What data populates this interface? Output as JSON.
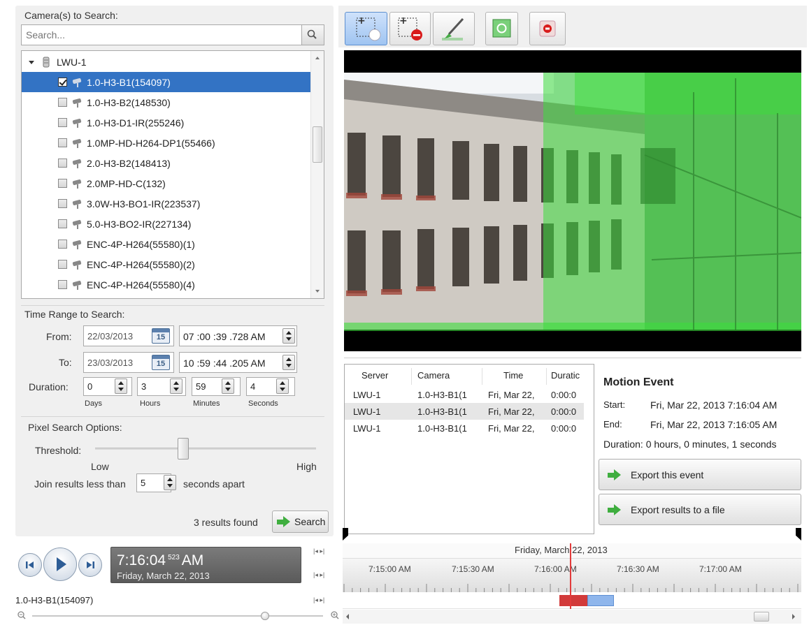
{
  "cameras": {
    "label": "Camera(s) to Search:",
    "search_placeholder": "Search...",
    "server": "LWU-1",
    "items": [
      {
        "label": "1.0-H3-B1(154097)",
        "checked": true,
        "selected": true
      },
      {
        "label": "1.0-H3-B2(148530)",
        "checked": false
      },
      {
        "label": "1.0-H3-D1-IR(255246)",
        "checked": false
      },
      {
        "label": "1.0MP-HD-H264-DP1(55466)",
        "checked": false
      },
      {
        "label": "2.0-H3-B2(148413)",
        "checked": false
      },
      {
        "label": "2.0MP-HD-C(132)",
        "checked": false
      },
      {
        "label": "3.0W-H3-BO1-IR(223537)",
        "checked": false
      },
      {
        "label": "5.0-H3-BO2-IR(227134)",
        "checked": false
      },
      {
        "label": "ENC-4P-H264(55580)(1)",
        "checked": false
      },
      {
        "label": "ENC-4P-H264(55580)(2)",
        "checked": false
      },
      {
        "label": "ENC-4P-H264(55580)(4)",
        "checked": false
      }
    ]
  },
  "time_range": {
    "label": "Time Range to Search:",
    "from_label": "From:",
    "from_date": "22/03/2013",
    "from_time": "07 :00 :39 .728  AM",
    "to_label": "To:",
    "to_date": "23/03/2013",
    "to_time": "10 :59 :44 .205  AM",
    "calendar_day": "15",
    "duration_label": "Duration:",
    "duration": {
      "days": "0",
      "hours": "3",
      "minutes": "59",
      "seconds": "4",
      "days_label": "Days",
      "hours_label": "Hours",
      "minutes_label": "Minutes",
      "seconds_label": "Seconds"
    }
  },
  "pixel_search": {
    "label": "Pixel Search Options:",
    "threshold_label": "Threshold:",
    "threshold_value": 0.4,
    "low_label": "Low",
    "high_label": "High",
    "join_prefix": "Join results less than",
    "join_value": "5",
    "join_suffix": "seconds apart"
  },
  "search": {
    "results_found": "3  results found",
    "button_label": "Search"
  },
  "player": {
    "time": "7:16:04",
    "ms": "523",
    "ampm": "AM",
    "date": "Friday, March 22, 2013",
    "camera_name": "1.0-H3-B1(154097)",
    "zoom_level": 0.8
  },
  "results_table": {
    "columns": [
      "Server",
      "Camera",
      "Time",
      "Duratic"
    ],
    "rows": [
      [
        "LWU-1",
        "1.0-H3-B1(1",
        "Fri, Mar 22,",
        "0:00:0"
      ],
      [
        "LWU-1",
        "1.0-H3-B1(1",
        "Fri, Mar 22,",
        "0:00:0"
      ],
      [
        "LWU-1",
        "1.0-H3-B1(1",
        "Fri, Mar 22,",
        "0:00:0"
      ]
    ]
  },
  "motion_event": {
    "title": "Motion Event",
    "start_label": "Start:",
    "start_value": "Fri, Mar 22, 2013 7:16:04 AM",
    "end_label": "End:",
    "end_value": "Fri, Mar 22, 2013 7:16:05 AM",
    "duration_text": "Duration: 0 hours, 0 minutes, 1 seconds",
    "export_event": "Export this event",
    "export_results": "Export results to a file"
  },
  "timeline": {
    "date": "Friday, March 22, 2013",
    "ticks": [
      "7:15:00 AM",
      "7:15:30 AM",
      "7:16:00 AM",
      "7:16:30 AM",
      "7:17:00 AM"
    ]
  },
  "colors": {
    "selection": "#3373c4",
    "motion_overlay": "#3cdc3c",
    "event_red": "#d23a3a",
    "event_blue": "#8fb6ec"
  }
}
